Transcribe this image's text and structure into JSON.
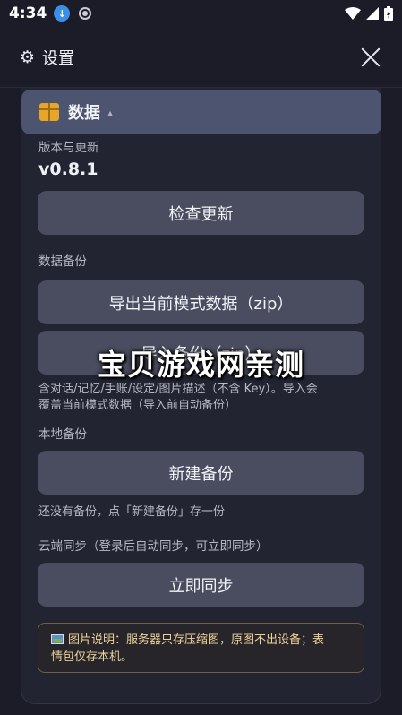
{
  "status": {
    "time": "4:34"
  },
  "header": {
    "title": "设置"
  },
  "section": {
    "title": "数据",
    "caret": "▲"
  },
  "version_section": {
    "label": "版本与更新",
    "version": "v0.8.1",
    "check_button": "检查更新"
  },
  "backup_section": {
    "label": "数据备份",
    "export_button": "导出当前模式数据（zip）",
    "import_button": "导入备份（zip）",
    "desc_line1": "含对话/记忆/手账/设定/图片描述（不含 Key）。导入会",
    "desc_line2": "覆盖当前模式数据（导入前自动备份）"
  },
  "local_section": {
    "label": "本地备份",
    "create_button": "新建备份",
    "empty_hint": "还没有备份，点「新建备份」存一份"
  },
  "cloud_section": {
    "label": "云端同步（登录后自动同步，可立即同步）",
    "sync_button": "立即同步"
  },
  "note": {
    "line1": "图片说明：服务器只存压缩图，原图不出设备；表",
    "line2": "情包仅存本机。"
  },
  "watermark": "宝贝游戏网亲测"
}
